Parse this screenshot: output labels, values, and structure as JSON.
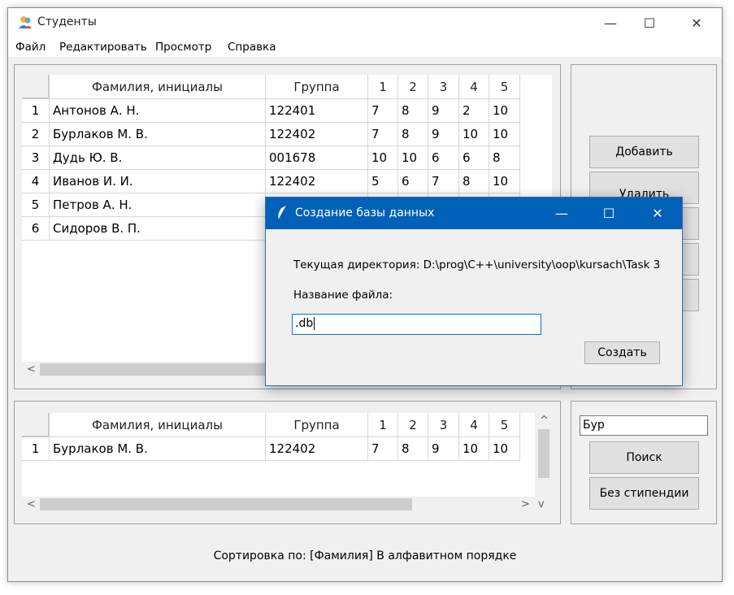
{
  "window": {
    "title": "Студенты",
    "controls": {
      "minimize": "—",
      "maximize": "☐",
      "close": "✕"
    }
  },
  "menu": [
    "Файл",
    "Редактировать",
    "Просмотр",
    "Справка"
  ],
  "main_table": {
    "columns": [
      "Фамилия, инициалы",
      "Группа",
      "1",
      "2",
      "3",
      "4",
      "5"
    ],
    "rows": [
      {
        "n": "1",
        "name": "Антонов А. Н.",
        "group": "122401",
        "g": [
          "7",
          "8",
          "9",
          "2",
          "10"
        ]
      },
      {
        "n": "2",
        "name": "Бурлаков М. В.",
        "group": "122402",
        "g": [
          "7",
          "8",
          "9",
          "10",
          "10"
        ]
      },
      {
        "n": "3",
        "name": "Дудь Ю. В.",
        "group": "001678",
        "g": [
          "10",
          "10",
          "6",
          "6",
          "8"
        ]
      },
      {
        "n": "4",
        "name": "Иванов И. И.",
        "group": "122402",
        "g": [
          "5",
          "6",
          "7",
          "8",
          "10"
        ]
      },
      {
        "n": "5",
        "name": "Петров А. Н.",
        "group": "",
        "g": [
          "",
          "",
          "",
          "",
          ""
        ]
      },
      {
        "n": "6",
        "name": "Сидоров В. П.",
        "group": "",
        "g": [
          "",
          "",
          "",
          "",
          ""
        ]
      }
    ]
  },
  "side_buttons": {
    "add": "Добавить",
    "delete": "Удалить"
  },
  "search_table": {
    "columns": [
      "Фамилия, инициалы",
      "Группа",
      "1",
      "2",
      "3",
      "4",
      "5"
    ],
    "rows": [
      {
        "n": "1",
        "name": "Бурлаков М. В.",
        "group": "122402",
        "g": [
          "7",
          "8",
          "9",
          "10",
          "10"
        ]
      }
    ]
  },
  "search": {
    "value": "Бур",
    "search_button": "Поиск",
    "no_scholarship_button": "Без стипендии"
  },
  "status": "Сортировка по: [Фамилия] В алфавитном порядке",
  "dialog": {
    "title": "Создание базы данных",
    "controls": {
      "minimize": "—",
      "maximize": "☐",
      "close": "✕"
    },
    "directory_label": "Текущая директория: D:\\prog\\C++\\university\\oop\\kursach\\Task 3",
    "filename_label": "Название файла:",
    "filename_value": ".db",
    "create_button": "Создать"
  },
  "scroll_arrows": {
    "left": "<",
    "right": ">",
    "up": "^",
    "down": "v"
  },
  "colors": {
    "dialog_titlebar": "#0161b9",
    "window_bg": "#f0f0f0"
  }
}
